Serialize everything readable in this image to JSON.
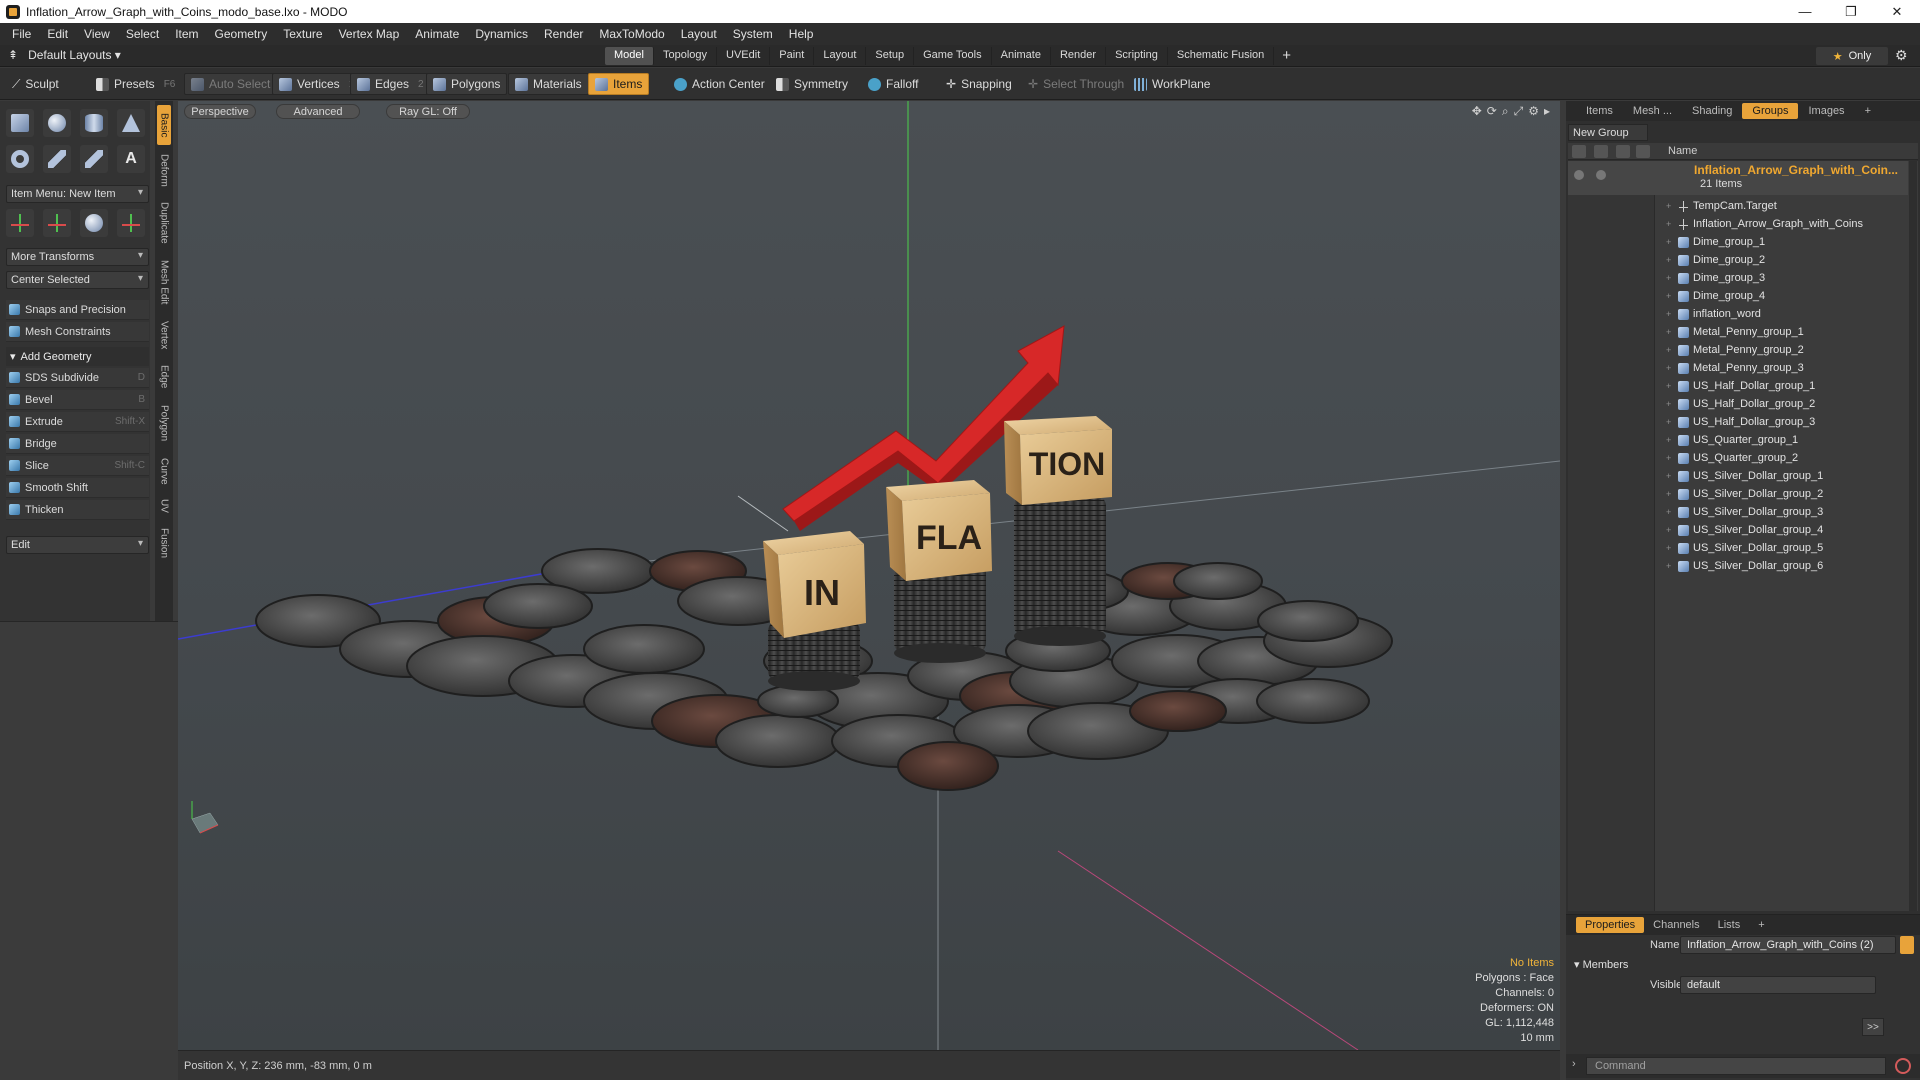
{
  "window": {
    "title": "Inflation_Arrow_Graph_with_Coins_modo_base.lxo - MODO",
    "controls": [
      "—",
      "❐",
      "✕"
    ]
  },
  "menu": [
    "File",
    "Edit",
    "View",
    "Select",
    "Item",
    "Geometry",
    "Texture",
    "Vertex Map",
    "Animate",
    "Dynamics",
    "Render",
    "MaxToModo",
    "Layout",
    "System",
    "Help"
  ],
  "layout_bar": {
    "layouts_label": "Default Layouts ▾",
    "tabs": [
      "Model",
      "Topology",
      "UVEdit",
      "Paint",
      "Layout",
      "Setup",
      "Game Tools",
      "Animate",
      "Render",
      "Scripting",
      "Schematic Fusion"
    ],
    "active_tab": "Model",
    "add": "+",
    "only": "Only"
  },
  "toolbar": {
    "sculpt": "Sculpt",
    "presets": "Presets",
    "presets_key": "F6",
    "auto_select": "Auto Select",
    "vertices": "Vertices",
    "vertices_count": "1",
    "edges": "Edges",
    "edges_count": "2",
    "polygons": "Polygons",
    "materials": "Materials",
    "items": "Items",
    "action_center": "Action Center",
    "symmetry": "Symmetry",
    "falloff": "Falloff",
    "snapping": "Snapping",
    "select_through": "Select Through",
    "workplane": "WorkPlane"
  },
  "left_panel": {
    "item_menu": "Item Menu: New Item",
    "more_transforms": "More Transforms",
    "center_selected": "Center Selected",
    "snaps": "Snaps and Precision",
    "mesh_constraints": "Mesh Constraints",
    "add_geometry": "Add Geometry",
    "tools": [
      {
        "label": "SDS Subdivide",
        "key": "D"
      },
      {
        "label": "Bevel",
        "key": "B"
      },
      {
        "label": "Extrude",
        "key": "Shift-X"
      },
      {
        "label": "Bridge",
        "key": ""
      },
      {
        "label": "Slice",
        "key": "Shift-C"
      },
      {
        "label": "Smooth Shift",
        "key": ""
      },
      {
        "label": "Thicken",
        "key": ""
      }
    ],
    "edit": "Edit",
    "vertical_tabs": [
      "Basic",
      "Deform",
      "Duplicate",
      "Mesh Edit",
      "Vertex",
      "Edge",
      "Polygon",
      "Curve",
      "UV",
      "Fusion"
    ]
  },
  "viewport": {
    "perspective": "Perspective",
    "advanced": "Advanced",
    "raygl": "Ray GL: Off",
    "nav_icons": [
      "✥",
      "⟳",
      "⌕",
      "⤢",
      "⚙",
      "▸"
    ],
    "cube_labels": [
      "IN",
      "FLA",
      "TION"
    ],
    "info": {
      "no_items": "No Items",
      "polygons": "Polygons : Face",
      "channels": "Channels: 0",
      "deformers": "Deformers: ON",
      "gl": "GL: 1,112,448",
      "scale": "10 mm"
    }
  },
  "status": {
    "position": "Position X, Y, Z:  236 mm, -83 mm, 0 m"
  },
  "right_panel": {
    "tabs": [
      "Items",
      "Mesh ...",
      "Shading",
      "Groups",
      "Images",
      "+"
    ],
    "active_tab": "Groups",
    "new_group": "New Group",
    "name_header": "Name",
    "root_name": "Inflation_Arrow_Graph_with_Coin...",
    "root_count": "21 Items",
    "children": [
      {
        "name": "TempCam.Target",
        "icon": "locator"
      },
      {
        "name": "Inflation_Arrow_Graph_with_Coins",
        "icon": "locator"
      },
      {
        "name": "Dime_group_1",
        "icon": "group"
      },
      {
        "name": "Dime_group_2",
        "icon": "group"
      },
      {
        "name": "Dime_group_3",
        "icon": "group"
      },
      {
        "name": "Dime_group_4",
        "icon": "group"
      },
      {
        "name": "inflation_word",
        "icon": "group"
      },
      {
        "name": "Metal_Penny_group_1",
        "icon": "group"
      },
      {
        "name": "Metal_Penny_group_2",
        "icon": "group"
      },
      {
        "name": "Metal_Penny_group_3",
        "icon": "group"
      },
      {
        "name": "US_Half_Dollar_group_1",
        "icon": "group"
      },
      {
        "name": "US_Half_Dollar_group_2",
        "icon": "group"
      },
      {
        "name": "US_Half_Dollar_group_3",
        "icon": "group"
      },
      {
        "name": "US_Quarter_group_1",
        "icon": "group"
      },
      {
        "name": "US_Quarter_group_2",
        "icon": "group"
      },
      {
        "name": "US_Silver_Dollar_group_1",
        "icon": "group"
      },
      {
        "name": "US_Silver_Dollar_group_2",
        "icon": "group"
      },
      {
        "name": "US_Silver_Dollar_group_3",
        "icon": "group"
      },
      {
        "name": "US_Silver_Dollar_group_4",
        "icon": "group"
      },
      {
        "name": "US_Silver_Dollar_group_5",
        "icon": "group"
      },
      {
        "name": "US_Silver_Dollar_group_6",
        "icon": "group"
      }
    ],
    "props_tabs": [
      "Properties",
      "Channels",
      "Lists",
      "+"
    ],
    "props_active": "Properties",
    "name_label": "Name",
    "name_value": "Inflation_Arrow_Graph_with_Coins (2)",
    "members": "Members",
    "visible_label": "Visible",
    "visible_value": "default",
    "more": ">>",
    "command_placeholder": "Command"
  },
  "colors": {
    "accent": "#e8a33a",
    "arrow": "#d92a2a",
    "wood": "#d9b888",
    "coin": "#5a5a5a"
  }
}
